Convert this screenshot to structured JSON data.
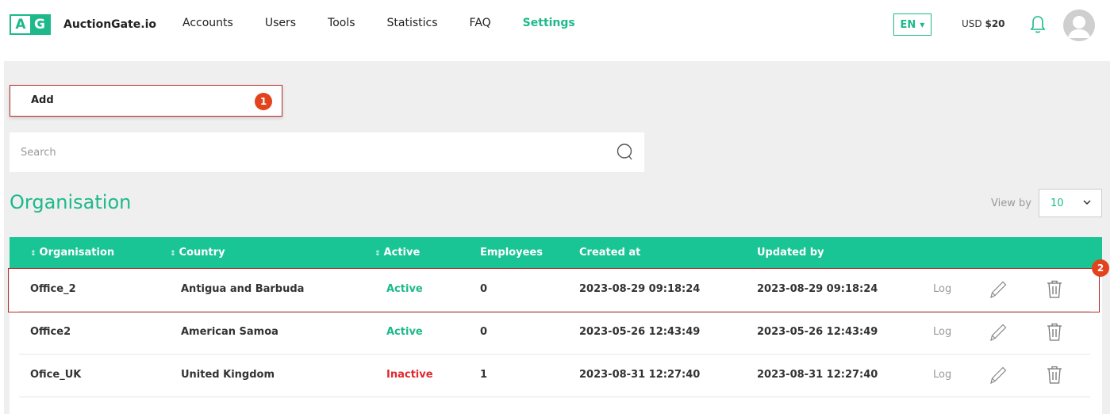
{
  "brand": {
    "logo_left": "A",
    "logo_right": "G",
    "name": "AuctionGate.io"
  },
  "nav": {
    "items": [
      {
        "label": "Accounts"
      },
      {
        "label": "Users"
      },
      {
        "label": "Tools"
      },
      {
        "label": "Statistics"
      },
      {
        "label": "FAQ"
      },
      {
        "label": "Settings",
        "active": true
      }
    ]
  },
  "header": {
    "language": "EN",
    "balance_currency": "USD",
    "balance_amount": "$20"
  },
  "toolbar": {
    "add_label": "Add",
    "add_badge": "1",
    "row_badge": "2"
  },
  "search": {
    "placeholder": "Search"
  },
  "page": {
    "title": "Organisation",
    "view_by_label": "View by",
    "view_by_value": "10"
  },
  "table": {
    "headers": [
      "Organisation",
      "Country",
      "Active",
      "Employees",
      "Created at",
      "Updated by"
    ],
    "rows": [
      {
        "organisation": "Office_2",
        "country": "Antigua and Barbuda",
        "active": "Active",
        "employees": "0",
        "created_at": "2023-08-29 09:18:24",
        "updated_by": "2023-08-29 09:18:24",
        "log": "Log"
      },
      {
        "organisation": "Office2",
        "country": "American Samoa",
        "active": "Active",
        "employees": "0",
        "created_at": "2023-05-26 12:43:49",
        "updated_by": "2023-05-26 12:43:49",
        "log": "Log"
      },
      {
        "organisation": "Ofice_UK",
        "country": "United Kingdom",
        "active": "Inactive",
        "employees": "1",
        "created_at": "2023-08-31 12:27:40",
        "updated_by": "2023-08-31 12:27:40",
        "log": "Log"
      }
    ]
  },
  "colors": {
    "accent": "#1db98a",
    "table_header": "#19c495",
    "inactive": "#e0282f",
    "badge": "#e2431d",
    "highlight_border": "#b52a2a",
    "content_bg": "#efefef"
  },
  "icons": [
    "search-icon",
    "bell-icon",
    "avatar-icon",
    "chevron-down-icon",
    "sort-icon",
    "pencil-icon",
    "trash-icon"
  ]
}
